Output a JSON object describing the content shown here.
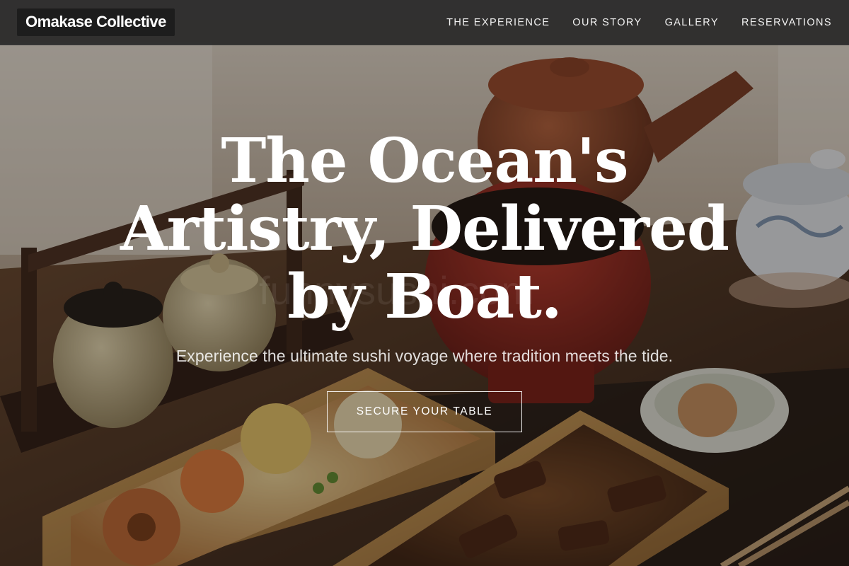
{
  "navbar": {
    "brand": "Omakase Collective",
    "links": [
      {
        "label": "THE EXPERIENCE"
      },
      {
        "label": "OUR STORY"
      },
      {
        "label": "GALLERY"
      },
      {
        "label": "RESERVATIONS"
      }
    ]
  },
  "hero": {
    "title": "The Ocean's Artistry, Delivered by Boat.",
    "subtitle": "Experience the ultimate sushi voyage where tradition meets the tide.",
    "cta_label": "SECURE YOUR TABLE",
    "watermark": "funnysushi.com"
  },
  "colors": {
    "nav_background": "#282828",
    "overlay": "#14100c",
    "text": "#ffffff"
  }
}
